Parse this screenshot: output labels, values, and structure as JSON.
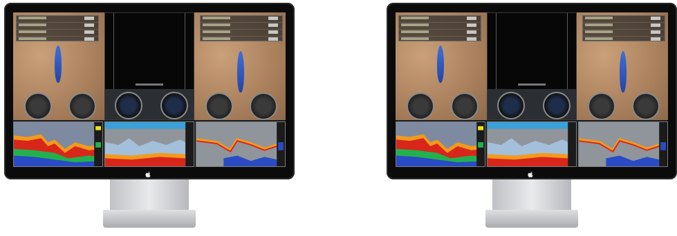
{
  "captions": [
    "",
    ""
  ],
  "monitors": [
    {
      "id": "left"
    },
    {
      "id": "right"
    }
  ],
  "colors": {
    "bezel": "#0b0b0b",
    "sand": "#b48a64",
    "sonar_red": "#d9261b",
    "sonar_orange": "#f39a1b",
    "sonar_yellow": "#e9e21a",
    "sonar_green": "#22b14c",
    "sonar_blue": "#2a4bc4",
    "water_gray": "#8f959a"
  },
  "icons": [
    "apple-logo-icon"
  ]
}
